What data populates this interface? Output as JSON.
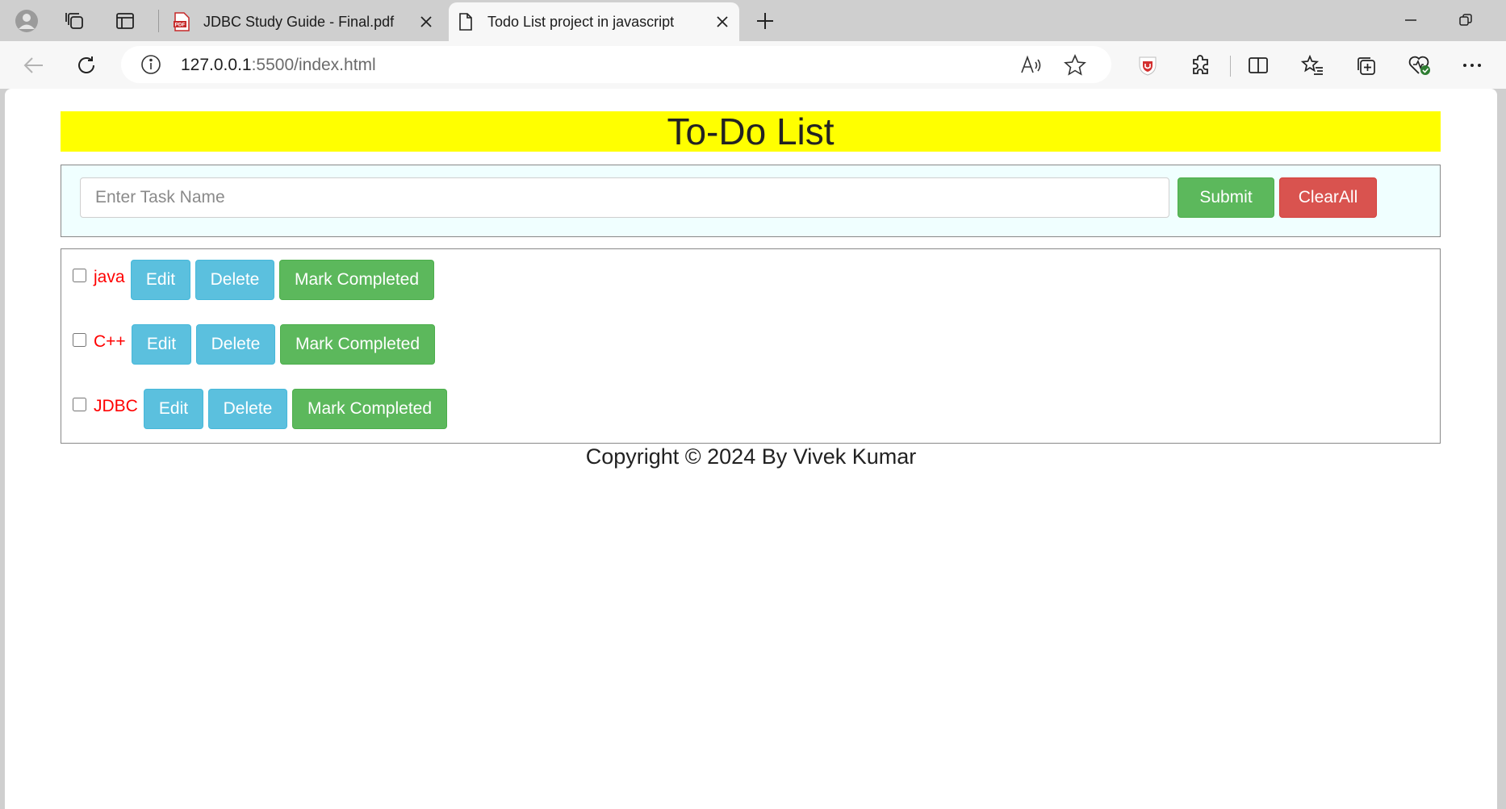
{
  "browser": {
    "tabs": [
      {
        "title": "JDBC Study Guide - Final.pdf",
        "favicon": "pdf-icon",
        "active": false
      },
      {
        "title": "Todo List project in javascript",
        "favicon": "page-icon",
        "active": true
      }
    ],
    "address": {
      "host": "127.0.0.1",
      "path": ":5500/index.html"
    },
    "icons": [
      "profile-icon",
      "workspaces-icon",
      "tab-actions-icon",
      "new-tab-icon",
      "minimize-icon",
      "restore-icon",
      "back-icon",
      "refresh-icon",
      "site-info-icon",
      "read-aloud-icon",
      "favorite-star-icon",
      "extension-shield-icon",
      "extensions-icon",
      "split-screen-icon",
      "favorites-icon",
      "collections-icon",
      "browser-essentials-icon",
      "more-icon"
    ]
  },
  "page": {
    "heading": "To-Do List",
    "heading_bg": "#ffff00",
    "form": {
      "placeholder": "Enter Task Name",
      "value": "",
      "submit_label": "Submit",
      "clear_label": "ClearAll"
    },
    "tasks": [
      {
        "name": "java",
        "checked": false,
        "edit_label": "Edit",
        "delete_label": "Delete",
        "complete_label": "Mark Completed"
      },
      {
        "name": "C++",
        "checked": false,
        "edit_label": "Edit",
        "delete_label": "Delete",
        "complete_label": "Mark Completed"
      },
      {
        "name": "JDBC",
        "checked": false,
        "edit_label": "Edit",
        "delete_label": "Delete",
        "complete_label": "Mark Completed"
      }
    ],
    "footer": "Copyright © 2024 By Vivek Kumar",
    "colors": {
      "green": "#5cb85c",
      "red": "#d9534f",
      "blue": "#5bc0de",
      "task_text": "#ff0000",
      "form_bg": "#f0ffff"
    }
  }
}
